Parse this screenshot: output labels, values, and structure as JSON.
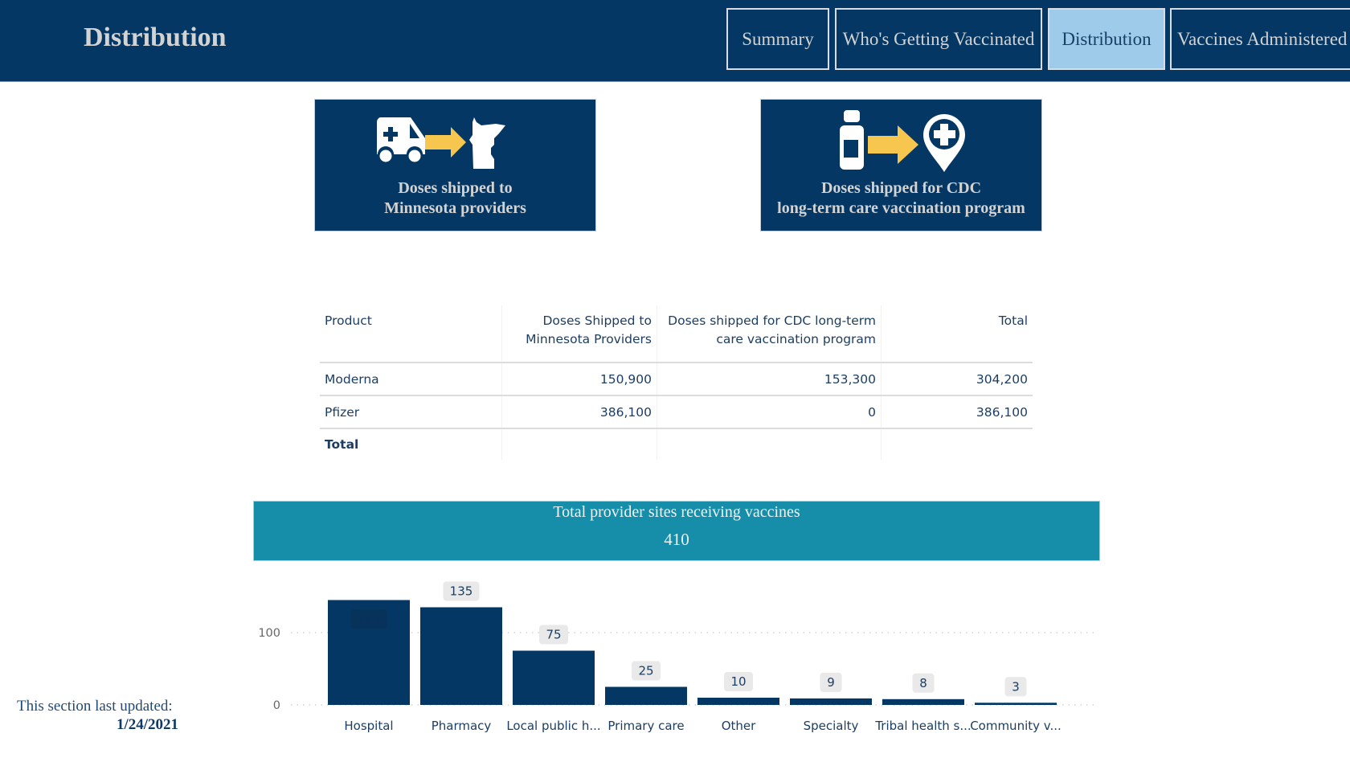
{
  "header": {
    "title": "Distribution",
    "tabs": [
      {
        "label": "Summary",
        "active": false
      },
      {
        "label": "Who's Getting Vaccinated",
        "active": false
      },
      {
        "label": "Distribution",
        "active": true
      },
      {
        "label": "Vaccines Administered",
        "active": false
      }
    ]
  },
  "cards": [
    {
      "label_line1": "Doses shipped to",
      "label_line2": "Minnesota providers",
      "icons": [
        "ambulance-icon",
        "arrow-right-icon",
        "minnesota-map-icon"
      ]
    },
    {
      "label_line1": "Doses shipped for CDC",
      "label_line2": "long-term care vaccination program",
      "icons": [
        "vaccine-vial-icon",
        "arrow-right-icon",
        "medical-location-pin-icon"
      ]
    }
  ],
  "colors": {
    "navy": "#043763",
    "active_tab": "#9ecbea",
    "arrow": "#f7c64f",
    "banner": "#178ea9",
    "bar": "#043763"
  },
  "table": {
    "headers": {
      "product": "Product",
      "mn_line1": "Doses Shipped to",
      "mn_line2": "Minnesota Providers",
      "cdc_line1": "Doses shipped for CDC long-term",
      "cdc_line2": "care vaccination program",
      "total": "Total"
    },
    "rows": [
      {
        "product": "Moderna",
        "mn": "150,900",
        "cdc": "153,300",
        "total": "304,200"
      },
      {
        "product": "Pfizer",
        "mn": "386,100",
        "cdc": "0",
        "total": "386,100"
      }
    ],
    "total_row_label": "Total"
  },
  "banner": {
    "title": "Total provider sites receiving vaccines",
    "value": "410"
  },
  "chart_data": {
    "type": "bar",
    "title": "",
    "xlabel": "",
    "ylabel": "",
    "categories": [
      "Hospital",
      "Pharmacy",
      "Local public h...",
      "Primary care",
      "Other",
      "Specialty",
      "Tribal health s...",
      "Community v..."
    ],
    "values": [
      145,
      135,
      75,
      25,
      10,
      9,
      8,
      3
    ],
    "data_labels": [
      "145",
      "135",
      "75",
      "25",
      "10",
      "9",
      "8",
      "3"
    ],
    "yticks": [
      0,
      100
    ],
    "ytick_labels": [
      "0",
      "100"
    ],
    "ylim": [
      0,
      150
    ],
    "grid": true,
    "legend": "none"
  },
  "footer": {
    "label": "This section last updated:",
    "date": "1/24/2021"
  }
}
